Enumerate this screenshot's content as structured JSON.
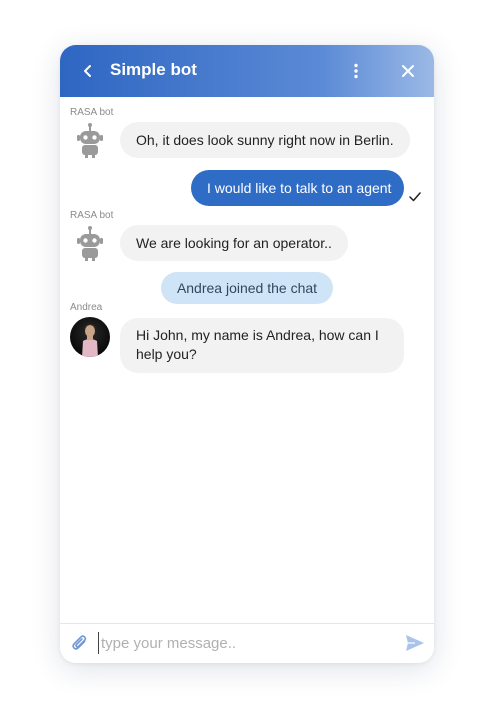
{
  "header": {
    "title": "Simple bot",
    "back_icon": "chevron-left-icon",
    "menu_icon": "more-vertical-icon",
    "close_icon": "close-icon",
    "gradient_start": "#2e66c2",
    "gradient_end": "#9bb9e6"
  },
  "messages": [
    {
      "sender": "RASA bot",
      "text": "Oh, it does look sunny right now in Berlin.",
      "from": "bot"
    },
    {
      "text": "I would like to talk to an agent",
      "from": "user",
      "status": "sent"
    },
    {
      "sender": "RASA bot",
      "text": "We are looking for an operator..",
      "from": "bot"
    },
    {
      "text": "Andrea joined the chat",
      "from": "system"
    },
    {
      "sender": "Andrea",
      "text_lines": [
        "Hi John, my name is Andrea, how can I",
        "help you?"
      ],
      "from": "agent"
    }
  ],
  "composer": {
    "placeholder": "type your message..",
    "value": "",
    "attach_icon": "paperclip-icon",
    "send_icon": "send-icon"
  },
  "colors": {
    "user_bubble": "#2f6cc5",
    "bot_bubble": "#f2f2f2",
    "system_bubble": "#cfe4f6"
  }
}
